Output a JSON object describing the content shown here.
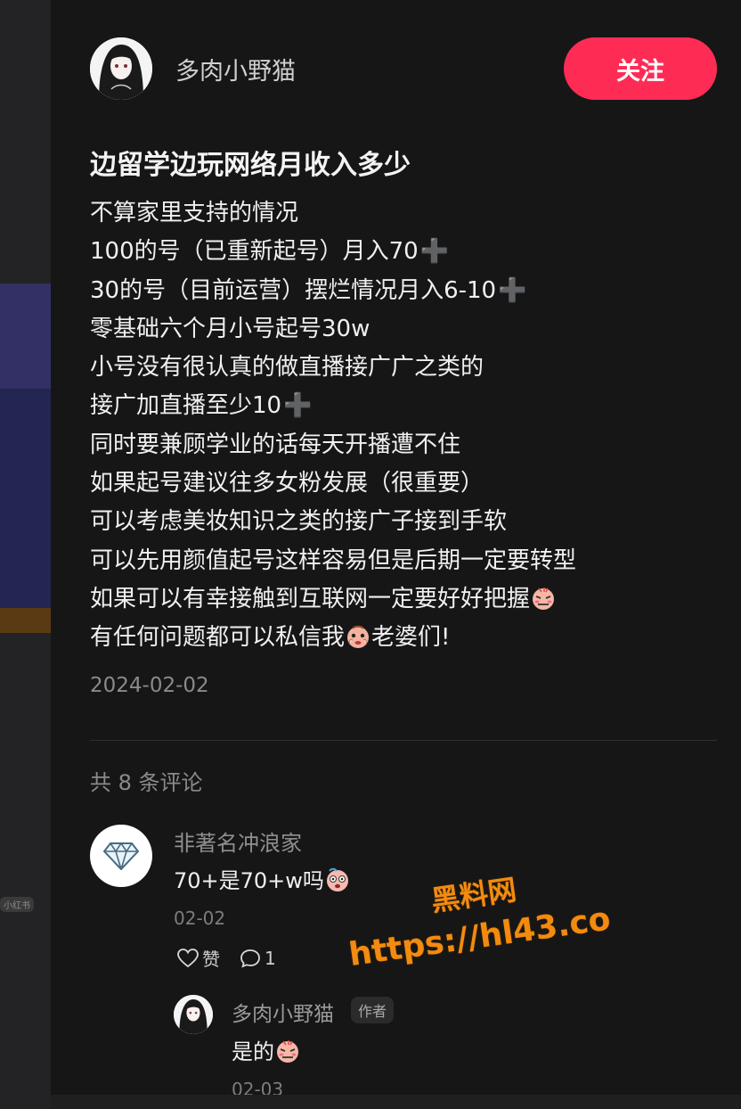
{
  "author": {
    "name": "多肉小野猫",
    "follow_label": "关注"
  },
  "post": {
    "title": "边留学边玩网络月收入多少",
    "lines": [
      {
        "text": "不算家里支持的情况",
        "plus": false,
        "emoji": ""
      },
      {
        "text": "100的号（已重新起号）月入70",
        "plus": true,
        "emoji": ""
      },
      {
        "text": "30的号（目前运营）摆烂情况月入6-10",
        "plus": true,
        "emoji": ""
      },
      {
        "text": "零基础六个月小号起号30w",
        "plus": false,
        "emoji": ""
      },
      {
        "text": "小号没有很认真的做直播接广广之类的",
        "plus": false,
        "emoji": ""
      },
      {
        "text": "接广加直播至少10",
        "plus": true,
        "emoji": ""
      },
      {
        "text": "同时要兼顾学业的话每天开播遭不住",
        "plus": false,
        "emoji": ""
      },
      {
        "text": "如果起号建议往多女粉发展（很重要）",
        "plus": false,
        "emoji": ""
      },
      {
        "text": "可以考虑美妆知识之类的接广子接到手软",
        "plus": false,
        "emoji": ""
      },
      {
        "text": "可以先用颜值起号这样容易但是后期一定要转型",
        "plus": false,
        "emoji": ""
      },
      {
        "text": "如果可以有幸接触到互联网一定要好好把握",
        "plus": false,
        "emoji": "embarrassed-emoji"
      },
      {
        "text": "有任何问题都可以私信我",
        "plus": false,
        "emoji": "pleading-emoji",
        "suffix": "老婆们!"
      }
    ],
    "date": "2024-02-02"
  },
  "comments": {
    "count_label": "共 8 条评论",
    "items": [
      {
        "user": "非著名冲浪家",
        "text": "70+是70+w吗",
        "emoji": "shocked-emoji",
        "date": "02-02",
        "like_label": "赞",
        "reply_count": "1",
        "replies": [
          {
            "user": "多肉小野猫",
            "badge": "作者",
            "text": "是的",
            "emoji": "embarrassed-emoji",
            "date": "02-03"
          }
        ]
      }
    ]
  },
  "watermark": {
    "title": "黑料网",
    "url": "https://hl43.co"
  },
  "left_panel": {
    "tag": "小红书"
  },
  "colors": {
    "accent": "#fe2c55",
    "background": "#161616",
    "watermark": "#f28b0f"
  }
}
